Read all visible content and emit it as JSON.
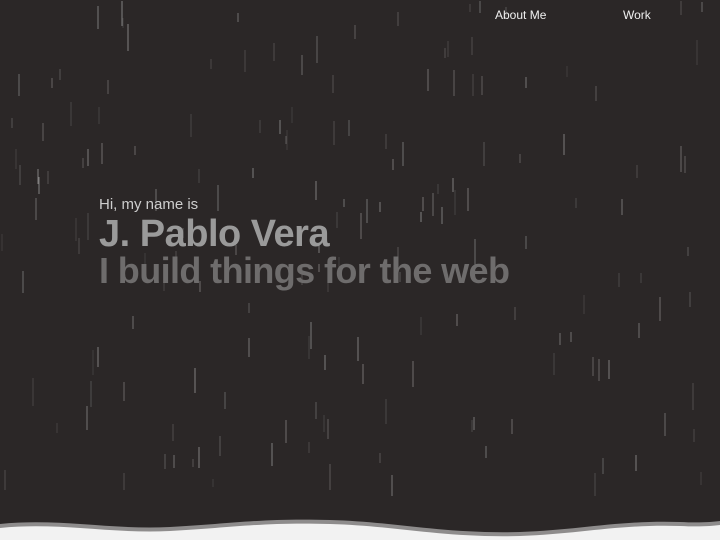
{
  "nav": {
    "about_label": "About Me",
    "work_label": "Work"
  },
  "hero": {
    "greeting": "Hi, my name is",
    "name": "J. Pablo Vera",
    "tagline": "I build things for the web"
  },
  "colors": {
    "background": "#2b2727",
    "rain": "#bdbdbd",
    "wave": "#f2f2f2"
  }
}
